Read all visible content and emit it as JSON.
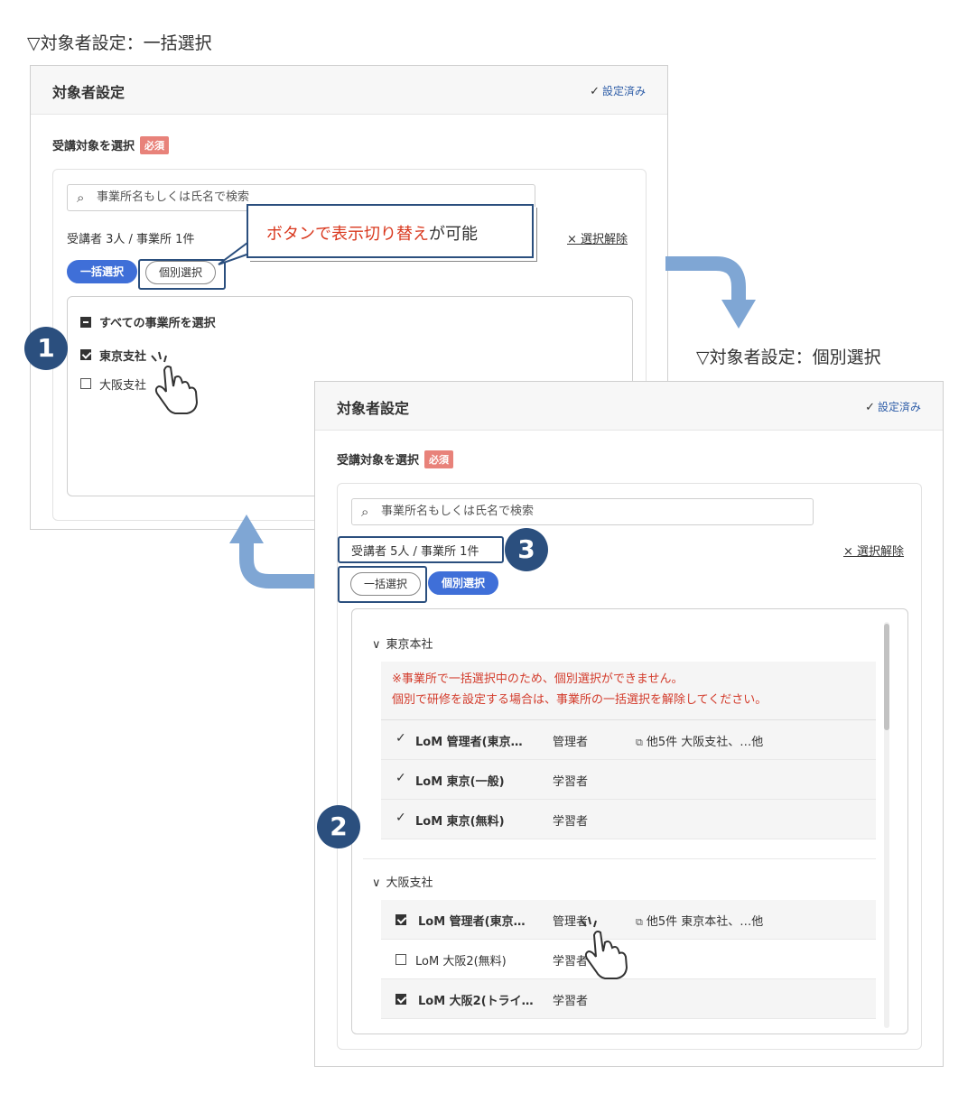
{
  "captions": {
    "bulk": "▽対象者設定：一括選択",
    "individual": "▽対象者設定：個別選択"
  },
  "panel1": {
    "title": "対象者設定",
    "done_label": "設定済み",
    "section_label": "受講対象を選択",
    "required_badge": "必須",
    "search_placeholder": "事業所名もしくは氏名で検索",
    "count_text": "受講者 3人 / 事業所 1件",
    "clear_label": "× 選択解除",
    "mode_bulk": "一括選択",
    "mode_individual": "個別選択",
    "select_all": "すべての事業所を選択",
    "offices": [
      {
        "label": "東京支社",
        "checked": true
      },
      {
        "label": "大阪支社",
        "checked": false
      }
    ]
  },
  "callout": {
    "red_text": "ボタンで表示切り替え",
    "rest_text": "が可能"
  },
  "panel2": {
    "title": "対象者設定",
    "done_label": "設定済み",
    "section_label": "受講対象を選択",
    "required_badge": "必須",
    "search_placeholder": "事業所名もしくは氏名で検索",
    "count_text": "受講者 5人 / 事業所 1件",
    "clear_label": "× 選択解除",
    "mode_bulk": "一括選択",
    "mode_individual": "個別選択",
    "groups": [
      {
        "name": "東京本社",
        "warning_line1": "※事業所で一括選択中のため、個別選択ができません。",
        "warning_line2": "個別で研修を設定する場合は、事業所の一括選択を解除してください。",
        "users": [
          {
            "name": "LoM 管理者(東京…",
            "role": "管理者",
            "other": "他5件 大阪支社、…他"
          },
          {
            "name": "LoM 東京(一般)",
            "role": "学習者",
            "other": ""
          },
          {
            "name": "LoM 東京(無料)",
            "role": "学習者",
            "other": ""
          }
        ]
      },
      {
        "name": "大阪支社",
        "users": [
          {
            "name": "LoM 管理者(東京…",
            "role": "管理者",
            "other": "他5件 東京本社、…他",
            "checked": true
          },
          {
            "name": "LoM 大阪2(無料)",
            "role": "学習者",
            "other": "",
            "checked": false
          },
          {
            "name": "LoM 大阪2(トライ…",
            "role": "学習者",
            "other": "",
            "checked": true
          }
        ]
      }
    ]
  },
  "steps": [
    "1",
    "2",
    "3"
  ],
  "colors": {
    "accent": "#3f6fd8",
    "highlight": "#2b4f7e",
    "arrow": "#7fa6d4",
    "required": "#e8827a",
    "warning": "#d33c2c"
  }
}
